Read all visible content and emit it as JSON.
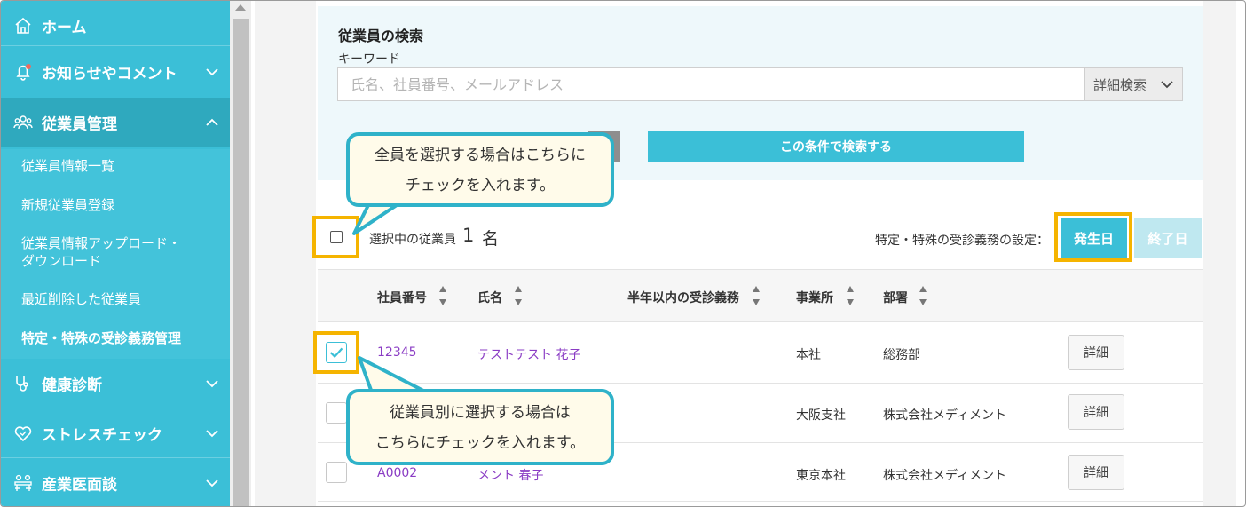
{
  "sidebar": {
    "items": [
      {
        "label": "ホーム",
        "icon": "home-icon"
      },
      {
        "label": "お知らせやコメント",
        "icon": "bell-icon"
      },
      {
        "label": "従業員管理",
        "icon": "people-icon"
      },
      {
        "label": "健康診断",
        "icon": "stethoscope-icon"
      },
      {
        "label": "ストレスチェック",
        "icon": "heart-icon"
      },
      {
        "label": "産業医面談",
        "icon": "meeting-icon"
      }
    ],
    "submenu": [
      "従業員情報一覧",
      "新規従業員登録",
      "従業員情報アップロード・",
      "ダウンロード",
      "最近削除した従業員",
      "特定・特殊の受診義務管理"
    ]
  },
  "search": {
    "title": "従業員の検索",
    "keyword_label": "キーワード",
    "placeholder": "氏名、社員番号、メールアドレス",
    "detail_label": "詳細検索",
    "submit_label": "この条件で検索する"
  },
  "selection": {
    "label": "選択中の従業員",
    "count": "1",
    "unit": "名",
    "setting_label": "特定・特殊の受診義務の設定：",
    "start_label": "発生日",
    "end_label": "終了日"
  },
  "table": {
    "headers": [
      "社員番号",
      "氏名",
      "半年以内の受診義務",
      "事業所",
      "部署"
    ],
    "detail_label": "詳細",
    "rows": [
      {
        "id": "12345",
        "name": "テストテスト 花子",
        "office": "本社",
        "dept": "総務部",
        "checked": true
      },
      {
        "id": "",
        "name": "",
        "office": "大阪支社",
        "dept": "株式会社メディメント",
        "checked": false
      },
      {
        "id": "A0002",
        "name": "メント 春子",
        "office": "東京本社",
        "dept": "株式会社メディメント",
        "checked": false
      }
    ]
  },
  "callouts": {
    "all_line1": "全員を選択する場合はこちらに",
    "all_line2": "チェックを入れます。",
    "each_line1": "従業員別に選択する場合は",
    "each_line2": "こちらにチェックを入れます。"
  },
  "colors": {
    "accent": "#3bbfd7",
    "highlight": "#f5b400",
    "link": "#8a3cc4",
    "callout_bg": "#fffbea"
  }
}
